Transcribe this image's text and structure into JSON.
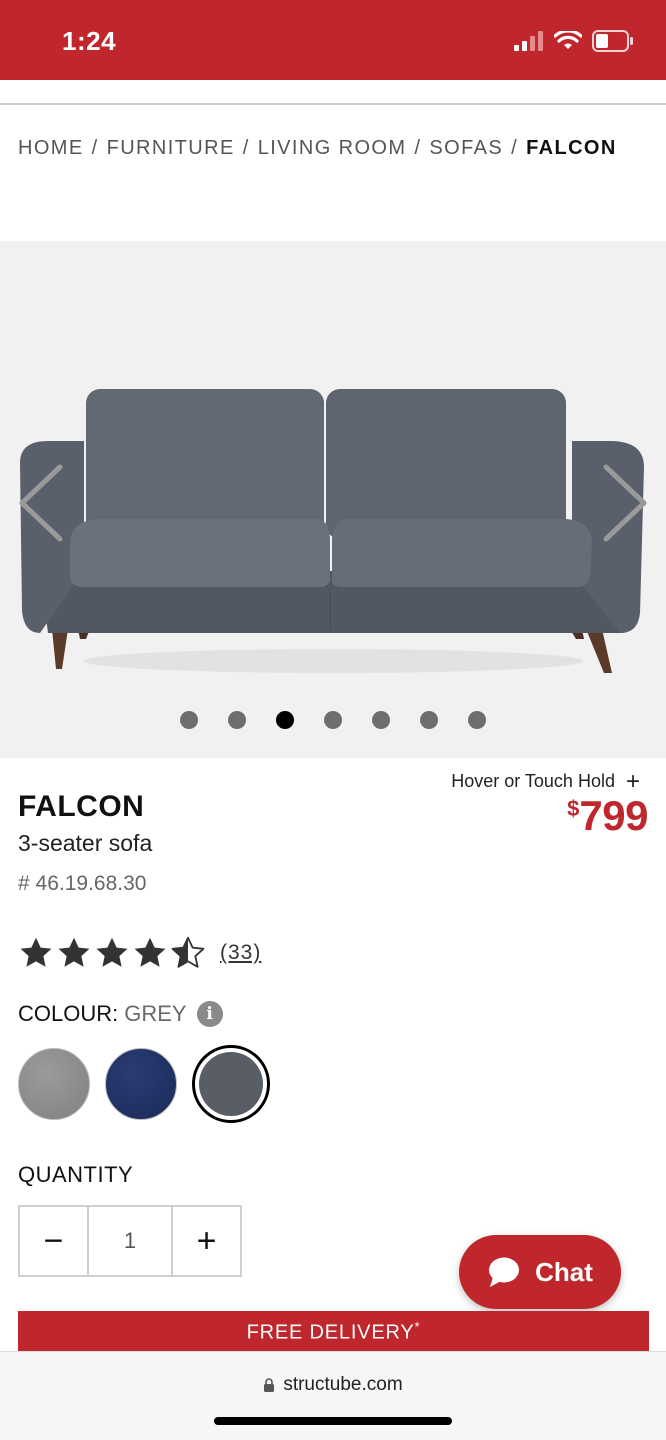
{
  "status_bar": {
    "time": "1:24",
    "bg_color": "#c0272d"
  },
  "breadcrumb": {
    "items": [
      "HOME",
      "FURNITURE",
      "LIVING ROOM",
      "SOFAS"
    ],
    "current": "FALCON",
    "separator": "/"
  },
  "gallery": {
    "image": "grey 3-seater sofa",
    "dots_total": 7,
    "active_dot": 3
  },
  "product": {
    "hover_hint": "Hover or Touch Hold",
    "hover_hint_icon": "plus-icon",
    "name": "FALCON",
    "description": "3-seater sofa",
    "sku": "# 46.19.68.30",
    "price_currency": "$",
    "price_amount": "799",
    "price_color": "#c0272d"
  },
  "rating": {
    "stars": 4.5,
    "max": 5,
    "review_count": "(33)"
  },
  "colour": {
    "label": "COLOUR:",
    "selected": "GREY",
    "info_icon": "info-icon",
    "swatches": [
      {
        "name": "light grey",
        "color": "#8e8e8e"
      },
      {
        "name": "navy",
        "color": "#1e2f62"
      },
      {
        "name": "grey",
        "color": "#585d66",
        "selected": true
      }
    ]
  },
  "quantity": {
    "label": "QUANTITY",
    "value": "1",
    "minus": "−",
    "plus": "+"
  },
  "chat": {
    "label": "Chat",
    "icon": "chat-bubble-icon"
  },
  "promo": {
    "title": "FREE DELIVERY",
    "asterisk": "*"
  },
  "browser": {
    "url": "structube.com",
    "lock_icon": "lock-icon"
  }
}
